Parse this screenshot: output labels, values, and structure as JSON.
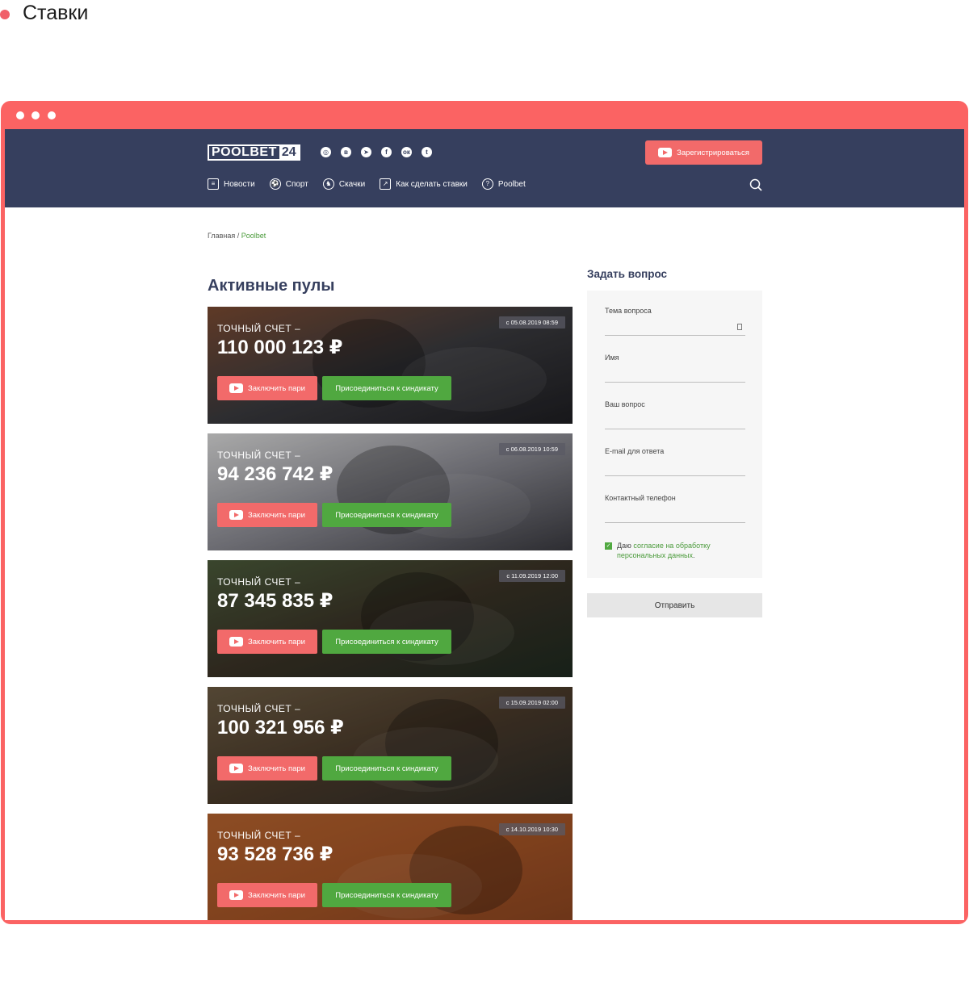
{
  "page_label": "Ставки",
  "header": {
    "logo_main": "POOLBET",
    "logo_num": "24",
    "socials": [
      {
        "name": "instagram-icon",
        "glyph": "◎"
      },
      {
        "name": "vk-icon",
        "glyph": "в"
      },
      {
        "name": "telegram-icon",
        "glyph": "➤"
      },
      {
        "name": "facebook-icon",
        "glyph": "f"
      },
      {
        "name": "odnoklassniki-icon",
        "glyph": "ок"
      },
      {
        "name": "twitter-icon",
        "glyph": "t"
      }
    ],
    "register_label": "Зарегистрироваться",
    "nav": [
      {
        "label": "Новости",
        "icon": "list-icon"
      },
      {
        "label": "Спорт",
        "icon": "ball-icon"
      },
      {
        "label": "Скачки",
        "icon": "horse-icon"
      },
      {
        "label": "Как сделать ставки",
        "icon": "chart-icon"
      },
      {
        "label": "Poolbet",
        "icon": "question-icon"
      }
    ]
  },
  "breadcrumb": {
    "home": "Главная",
    "separator": " / ",
    "current": "Poolbet"
  },
  "pools_title": "Активные пулы",
  "pools": [
    {
      "label": "ТОЧНЫЙ СЧЕТ –",
      "amount": "110 000 123 ₽",
      "date": "с 05.08.2019 08:59",
      "bet_label": "Заключить пари",
      "join_label": "Присоединиться к синдикату",
      "theme": "football"
    },
    {
      "label": "ТОЧНЫЙ СЧЕТ –",
      "amount": "94 236 742 ₽",
      "date": "с 06.08.2019 10:59",
      "bet_label": "Заключить пари",
      "join_label": "Присоединиться к синдикату",
      "theme": "hockey"
    },
    {
      "label": "ТОЧНЫЙ СЧЕТ –",
      "amount": "87 345 835 ₽",
      "date": "с 11.09.2019 12:00",
      "bet_label": "Заключить пари",
      "join_label": "Присоединиться к синдикату",
      "theme": "horses"
    },
    {
      "label": "ТОЧНЫЙ СЧЕТ –",
      "amount": "100 321 956 ₽",
      "date": "с 15.09.2019 02:00",
      "bet_label": "Заключить пари",
      "join_label": "Присоединиться к синдикату",
      "theme": "harness"
    },
    {
      "label": "ТОЧНЫЙ СЧЕТ –",
      "amount": "93 528 736 ₽",
      "date": "с 14.10.2019 10:30",
      "bet_label": "Заключить пари",
      "join_label": "Присоединиться к синдикату",
      "theme": "tennis"
    }
  ],
  "ask": {
    "title": "Задать вопрос",
    "fields": [
      {
        "label": "Тема вопроса",
        "value": ""
      },
      {
        "label": "Имя",
        "value": ""
      },
      {
        "label": "Ваш вопрос",
        "value": ""
      },
      {
        "label": "E-mail для ответа",
        "value": ""
      },
      {
        "label": "Контактный телефон",
        "value": ""
      }
    ],
    "consent_prefix": "Даю ",
    "consent_link": "согласие на обработку персональных данных",
    "consent_suffix": ".",
    "consent_checked": true,
    "submit_label": "Отправить"
  },
  "colors": {
    "header": "#363f5e",
    "accent_red": "#f26a6a",
    "accent_green": "#50a840",
    "frame": "#fb6363"
  }
}
